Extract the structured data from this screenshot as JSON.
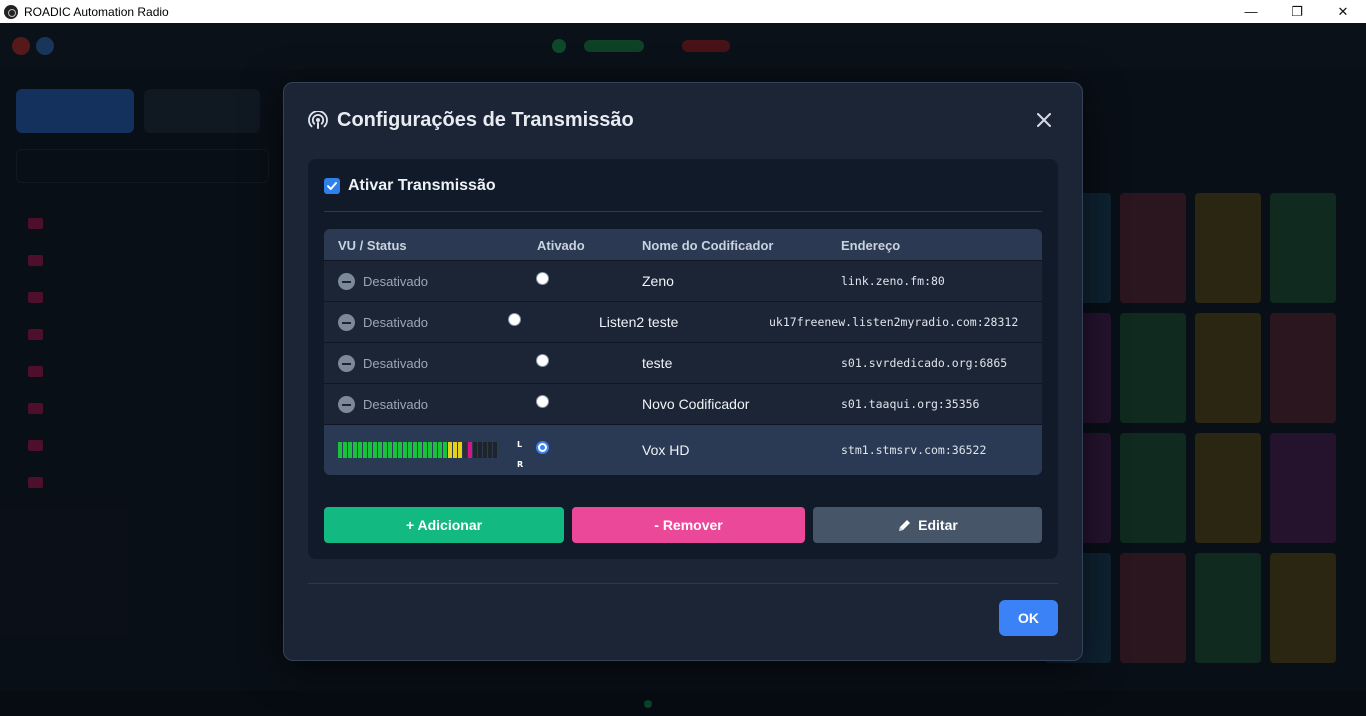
{
  "window": {
    "title": "ROADIC Automation Radio",
    "minimize": "—",
    "maximize": "❐",
    "close": "✕"
  },
  "modal": {
    "title": "Configurações de Transmissão",
    "enable_label": "Ativar Transmissão",
    "enable_checked": true,
    "columns": {
      "status": "VU / Status",
      "enabled": "Ativado",
      "name": "Nome do Codificador",
      "address": "Endereço"
    },
    "rows": [
      {
        "status": "Desativado",
        "name": "Zeno",
        "address": "link.zeno.fm:80"
      },
      {
        "status": "Desativado",
        "name": "Listen2 teste",
        "address": "uk17freenew.listen2myradio.com:28312"
      },
      {
        "status": "Desativado",
        "name": "teste",
        "address": "s01.svrdedicado.org:6865"
      },
      {
        "status": "Desativado",
        "name": "Novo Codificador",
        "address": "s01.taaqui.org:35356"
      },
      {
        "status": "",
        "name": "Vox HD",
        "address": "stm1.stmsrv.com:36522",
        "vu_left": "L",
        "vu_right": "R"
      }
    ],
    "buttons": {
      "add": "+ Adicionar",
      "remove": "- Remover",
      "edit": "Editar",
      "ok": "OK"
    }
  },
  "colors": {
    "accent": "#3b82f6",
    "add": "#12b981",
    "remove": "#ec4899",
    "edit": "#475569"
  }
}
